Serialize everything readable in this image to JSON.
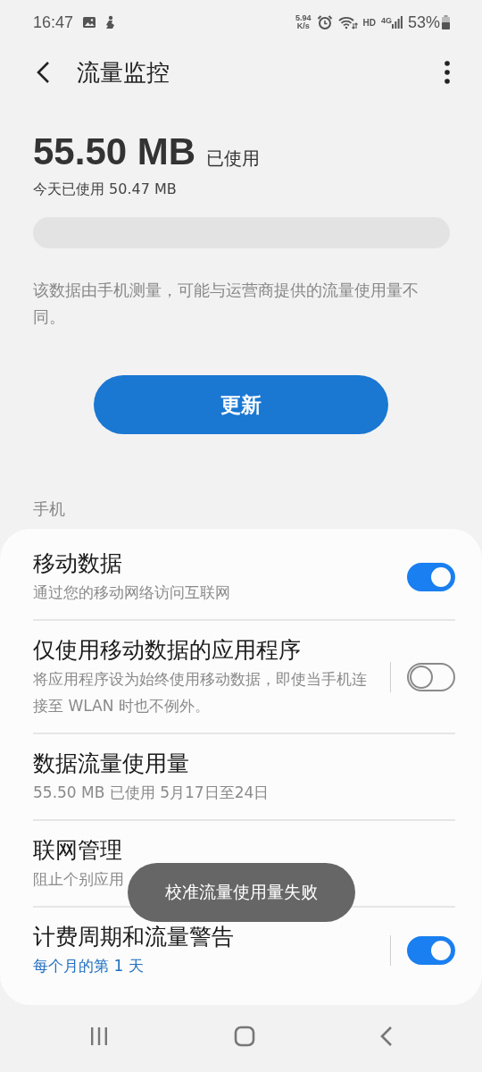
{
  "status_bar": {
    "time": "16:47",
    "speed_value": "5.94",
    "speed_unit": "K/s",
    "hd": "HD",
    "network": "4G",
    "battery": "53%"
  },
  "header": {
    "title": "流量监控"
  },
  "usage": {
    "amount": "55.50 MB",
    "suffix": "已使用",
    "today": "今天已使用 50.47 MB",
    "level": 0
  },
  "note": "该数据由手机测量，可能与运营商提供的流量使用量不同。",
  "update_button": "更新",
  "section_label": "手机",
  "rows": [
    {
      "kind": "switch",
      "title": "移动数据",
      "subtitle": "通过您的移动网络访问互联网",
      "on": true,
      "split": false,
      "subtitle_accent": false
    },
    {
      "kind": "switch",
      "title": "仅使用移动数据的应用程序",
      "subtitle": "将应用程序设为始终使用移动数据，即使当手机连接至 WLAN 时也不例外。",
      "on": false,
      "split": true,
      "subtitle_accent": false
    },
    {
      "kind": "plain",
      "title": "数据流量使用量",
      "subtitle": "55.50 MB 已使用 5月17日至24日",
      "subtitle_accent": false
    },
    {
      "kind": "plain",
      "title": "联网管理",
      "subtitle": "阻止个别应用",
      "subtitle_accent": false
    },
    {
      "kind": "switch",
      "title": "计费周期和流量警告",
      "subtitle": "每个月的第 1 天",
      "on": true,
      "split": true,
      "subtitle_accent": true
    }
  ],
  "toast": "校准流量使用量失败"
}
